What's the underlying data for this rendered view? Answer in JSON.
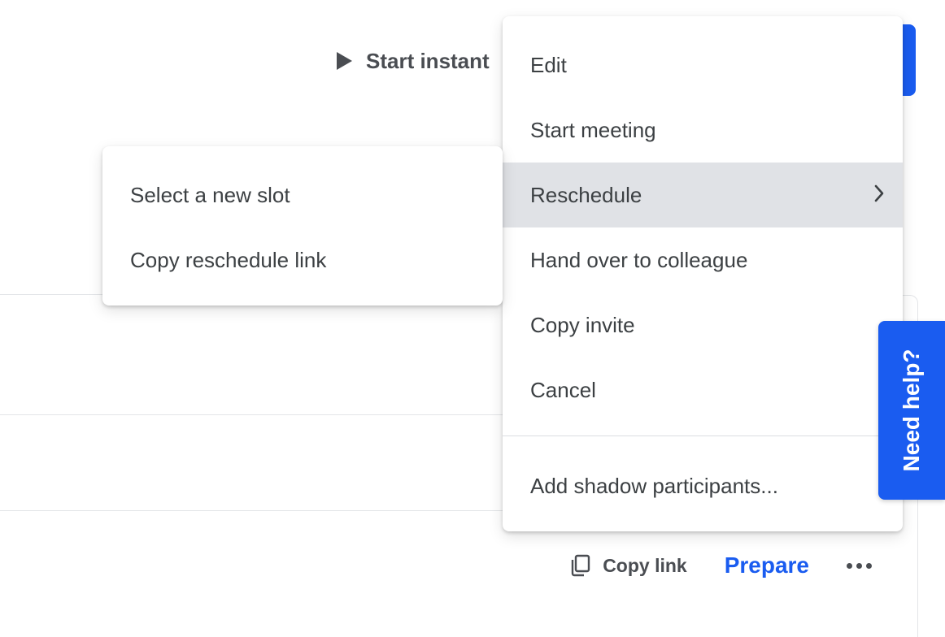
{
  "toolbar": {
    "start_instant_label": "Start instant",
    "play_icon": "play-icon"
  },
  "row": {
    "copy_link_label": "Copy link",
    "copy_icon": "copy-icon",
    "prepare_label": "Prepare",
    "more_icon": "more-horizontal-icon"
  },
  "main_menu": {
    "items": [
      {
        "label": "Edit"
      },
      {
        "label": "Start meeting"
      },
      {
        "label": "Reschedule",
        "has_submenu": true,
        "active": true
      },
      {
        "label": "Hand over to colleague"
      },
      {
        "label": "Copy invite"
      },
      {
        "label": "Cancel"
      },
      {
        "label": "Add shadow participants..."
      }
    ]
  },
  "sub_menu": {
    "items": [
      {
        "label": "Select a new slot"
      },
      {
        "label": "Copy reschedule link"
      }
    ]
  },
  "help": {
    "label": "Need help?"
  },
  "colors": {
    "accent": "#1a5cf0",
    "menu_hover": "#e0e2e6",
    "text": "#3c4043"
  }
}
